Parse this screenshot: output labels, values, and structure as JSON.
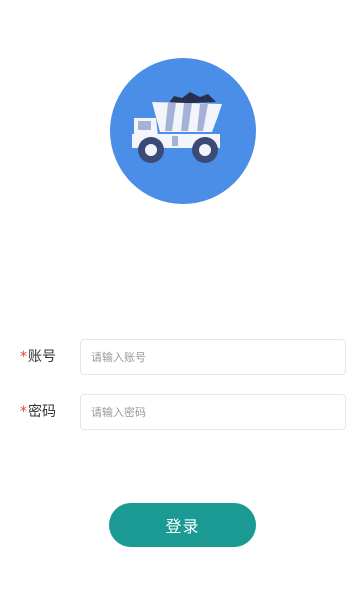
{
  "logo": {
    "icon": "dump-truck-icon",
    "circle_color": "#4a8ee8",
    "truck_body_color": "#f3f5fa",
    "stripe_color": "#a5b1d8",
    "load_color": "#27314f",
    "wheel_color": "#3c4a78"
  },
  "form": {
    "account": {
      "required_mark": "*",
      "label": "账号",
      "placeholder": "请输入账号",
      "value": ""
    },
    "password": {
      "required_mark": "*",
      "label": "密码",
      "placeholder": "请输入密码",
      "value": ""
    }
  },
  "login_button": {
    "label": "登录",
    "color": "#1a9a93"
  }
}
